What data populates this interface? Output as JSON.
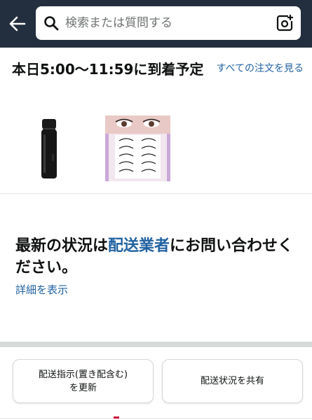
{
  "header": {
    "back_icon": "arrow-left-icon",
    "search_placeholder": "検索または質問する",
    "search_icon": "search-icon",
    "lens_icon": "camera-search-icon"
  },
  "delivery": {
    "heading": "本日5:00〜11:59に到着予定",
    "all_orders_link": "すべての注文を見る",
    "products": [
      {
        "name": "black-thermos-bottle"
      },
      {
        "name": "false-eyelashes-pack"
      }
    ]
  },
  "status": {
    "text_before": "最新の状況は",
    "carrier_link": "配送業者",
    "text_after": "にお問い合わせください。",
    "details_link": "詳細を表示"
  },
  "actions": {
    "update_instructions": "配送指示(置き配含む)\nを更新",
    "share_status": "配送状況を共有"
  },
  "colors": {
    "topbar": "#232f3e",
    "link": "#2162a1",
    "text": "#0f1111"
  }
}
